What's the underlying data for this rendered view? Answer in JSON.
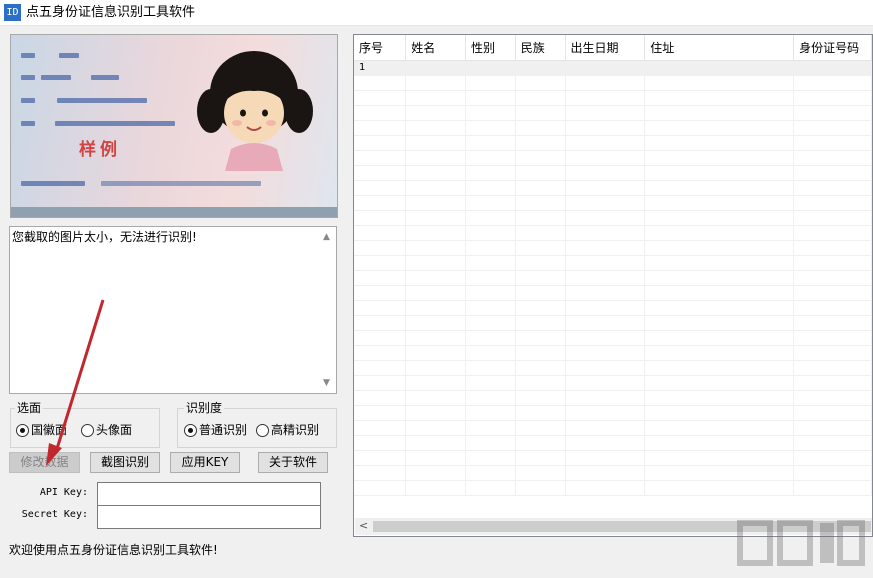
{
  "window": {
    "title": "点五身份证信息识别工具软件",
    "icon_text": "ID"
  },
  "log": {
    "message": "您截取的图片太小，无法进行识别!"
  },
  "photo": {
    "sample_text": "样例"
  },
  "side_group": {
    "label": "选面",
    "options": [
      {
        "label": "国徽面",
        "checked": true
      },
      {
        "label": "头像面",
        "checked": false
      }
    ]
  },
  "accuracy_group": {
    "label": "识别度",
    "options": [
      {
        "label": "普通识别",
        "checked": true
      },
      {
        "label": "高精识别",
        "checked": false
      }
    ]
  },
  "buttons": {
    "modify": "修改数据",
    "capture": "截图识别",
    "apply_key": "应用KEY",
    "about": "关于软件"
  },
  "fields": {
    "api_key_label": "API Key:",
    "api_key_value": "",
    "secret_key_label": "Secret Key:",
    "secret_key_value": ""
  },
  "table": {
    "columns": [
      "序号",
      "姓名",
      "性别",
      "民族",
      "出生日期",
      "住址",
      "身份证号码"
    ],
    "rows": [
      [
        "1",
        "",
        "",
        "",
        "",
        "",
        ""
      ]
    ]
  },
  "status": {
    "text": "欢迎使用点五身份证信息识别工具软件!"
  },
  "colors": {
    "arrow": "#c0282d",
    "icon_bg": "#2b6fc7"
  }
}
